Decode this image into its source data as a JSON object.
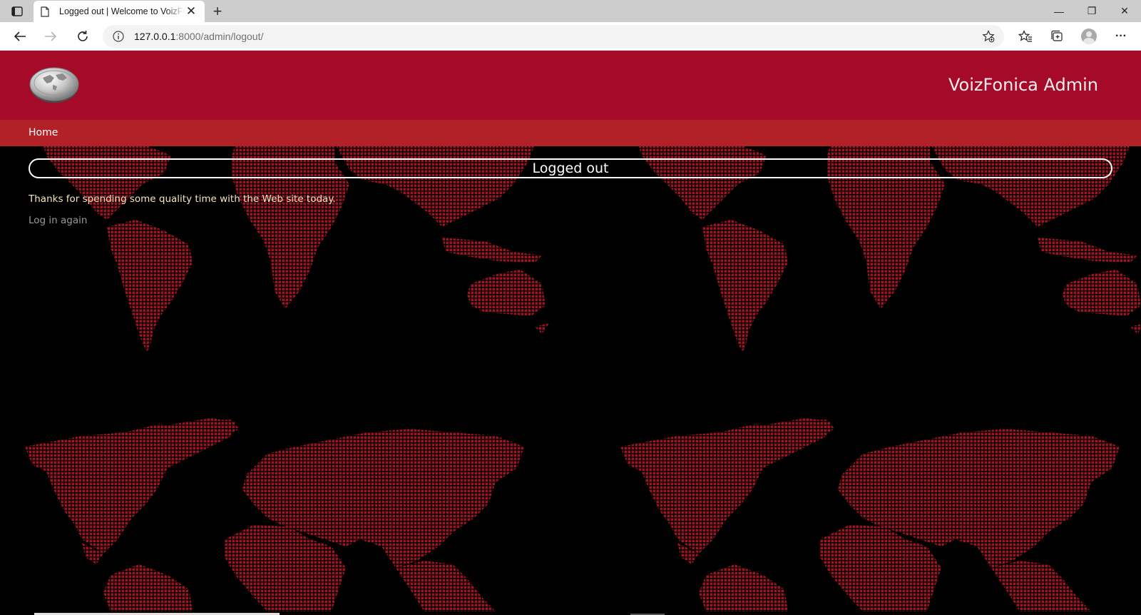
{
  "browser": {
    "tab": {
      "title": "Logged out | Welcome to VoizFonica",
      "close_label": "✕"
    },
    "new_tab_label": "+",
    "url_host": "127.0.0.1",
    "url_rest": ":8000/admin/logout/",
    "window": {
      "minimize": "—",
      "restore": "❐",
      "close": "✕"
    },
    "more_label": "···"
  },
  "site": {
    "brand": "VoizFonica Admin",
    "header_color": "#a50a28",
    "nav_color": "#b22028",
    "nav": {
      "home": "Home"
    }
  },
  "content": {
    "title": "Logged out",
    "message": "Thanks for spending some quality time with the Web site today.",
    "login_again": "Log in again"
  },
  "icons": {
    "tab_actions": "tab-actions-icon",
    "page": "page-icon",
    "back": "back-arrow-icon",
    "forward": "forward-arrow-icon",
    "refresh": "refresh-icon",
    "info": "info-icon",
    "add_favorite": "add-favorite-icon",
    "favorites": "favorites-icon",
    "collections": "collections-icon",
    "profile": "profile-avatar",
    "logo": "globe-logo-icon"
  }
}
